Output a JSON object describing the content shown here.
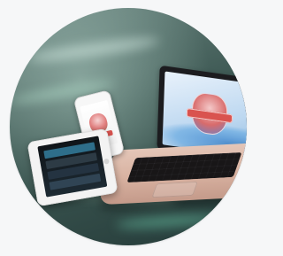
{
  "scene": {
    "type": "devices-illustration",
    "background": "blurred-green-circuit",
    "accent_colors": {
      "laptop_body": "#d9b3a2",
      "screen_blue": "#7fb0d8",
      "badge_red": "#d9534f"
    }
  },
  "devices": {
    "laptop": {
      "icon": "laptop-icon"
    },
    "phone": {
      "icon": "phone-icon"
    },
    "tablet": {
      "icon": "tablet-icon"
    }
  }
}
